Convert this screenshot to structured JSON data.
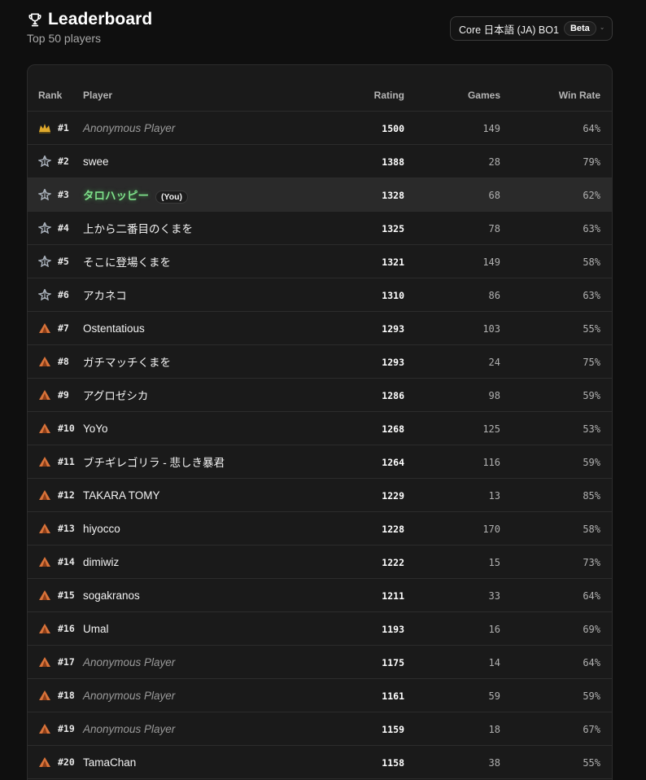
{
  "header": {
    "title": "Leaderboard",
    "subtitle": "Top 50 players",
    "selector_label": "Core 日本語 (JA) BO1",
    "selector_badge": "Beta"
  },
  "columns": {
    "rank": "Rank",
    "player": "Player",
    "rating": "Rating",
    "games": "Games",
    "win_rate": "Win Rate"
  },
  "you_badge": "(You)",
  "colors": {
    "gold": "#e0a92c",
    "silver": "#a9b1bb",
    "bronze": "#d9733a",
    "self": "#7ee08a"
  },
  "rows": [
    {
      "rank": "#1",
      "tier": "gold",
      "player": "Anonymous Player",
      "anon": true,
      "rating": "1500",
      "games": "149",
      "win": "64%"
    },
    {
      "rank": "#2",
      "tier": "silver",
      "player": "swee",
      "rating": "1388",
      "games": "28",
      "win": "79%"
    },
    {
      "rank": "#3",
      "tier": "silver",
      "player": "タロハッピー",
      "you": true,
      "rating": "1328",
      "games": "68",
      "win": "62%"
    },
    {
      "rank": "#4",
      "tier": "silver",
      "player": "上から二番目のくまを",
      "rating": "1325",
      "games": "78",
      "win": "63%"
    },
    {
      "rank": "#5",
      "tier": "silver",
      "player": "そこに登場くまを",
      "rating": "1321",
      "games": "149",
      "win": "58%"
    },
    {
      "rank": "#6",
      "tier": "silver",
      "player": "アカネコ",
      "rating": "1310",
      "games": "86",
      "win": "63%"
    },
    {
      "rank": "#7",
      "tier": "bronze",
      "player": "Ostentatious",
      "rating": "1293",
      "games": "103",
      "win": "55%"
    },
    {
      "rank": "#8",
      "tier": "bronze",
      "player": "ガチマッチくまを",
      "rating": "1293",
      "games": "24",
      "win": "75%"
    },
    {
      "rank": "#9",
      "tier": "bronze",
      "player": "アグロゼシカ",
      "rating": "1286",
      "games": "98",
      "win": "59%"
    },
    {
      "rank": "#10",
      "tier": "bronze",
      "player": "YoYo",
      "rating": "1268",
      "games": "125",
      "win": "53%"
    },
    {
      "rank": "#11",
      "tier": "bronze",
      "player": "ブチギレゴリラ - 悲しき暴君",
      "rating": "1264",
      "games": "116",
      "win": "59%"
    },
    {
      "rank": "#12",
      "tier": "bronze",
      "player": "TAKARA TOMY",
      "rating": "1229",
      "games": "13",
      "win": "85%"
    },
    {
      "rank": "#13",
      "tier": "bronze",
      "player": "hiyocco",
      "rating": "1228",
      "games": "170",
      "win": "58%"
    },
    {
      "rank": "#14",
      "tier": "bronze",
      "player": "dimiwiz",
      "rating": "1222",
      "games": "15",
      "win": "73%"
    },
    {
      "rank": "#15",
      "tier": "bronze",
      "player": "sogakranos",
      "rating": "1211",
      "games": "33",
      "win": "64%"
    },
    {
      "rank": "#16",
      "tier": "bronze",
      "player": "Umal",
      "rating": "1193",
      "games": "16",
      "win": "69%"
    },
    {
      "rank": "#17",
      "tier": "bronze",
      "player": "Anonymous Player",
      "anon": true,
      "rating": "1175",
      "games": "14",
      "win": "64%"
    },
    {
      "rank": "#18",
      "tier": "bronze",
      "player": "Anonymous Player",
      "anon": true,
      "rating": "1161",
      "games": "59",
      "win": "59%"
    },
    {
      "rank": "#19",
      "tier": "bronze",
      "player": "Anonymous Player",
      "anon": true,
      "rating": "1159",
      "games": "18",
      "win": "67%"
    },
    {
      "rank": "#20",
      "tier": "bronze",
      "player": "TamaChan",
      "rating": "1158",
      "games": "38",
      "win": "55%"
    }
  ]
}
